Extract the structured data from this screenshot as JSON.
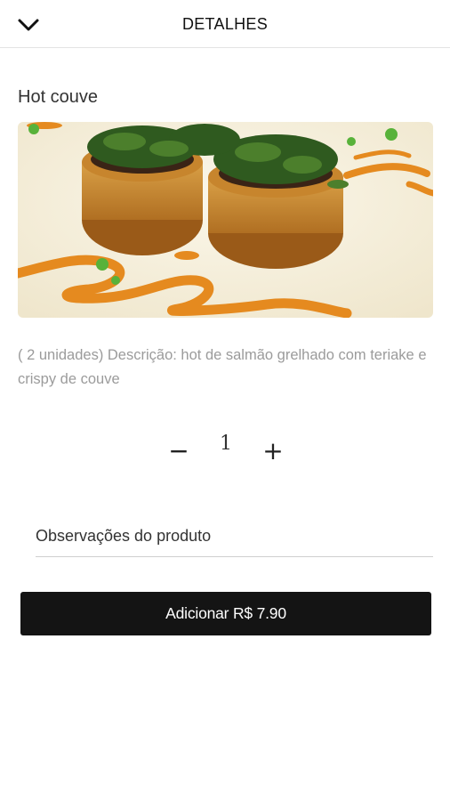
{
  "header": {
    "title": "DETALHES",
    "back_icon": "chevron-down-icon"
  },
  "product": {
    "name": "Hot couve",
    "description": "( 2 unidades) Descrição: hot de salmão grelhado com teriake e crispy de couve",
    "image_alt": "Hot couve"
  },
  "quantity": {
    "minus_label": "−",
    "value": "1",
    "plus_label": "+"
  },
  "observations": {
    "placeholder": "Observações do produto",
    "value": ""
  },
  "add_button": {
    "label": "Adicionar R$ 7.90"
  },
  "colors": {
    "button_bg": "#141414",
    "description_text": "#9b9b9b",
    "sauce_orange": "#e58a1f",
    "herb_green": "#2f5a1f"
  }
}
